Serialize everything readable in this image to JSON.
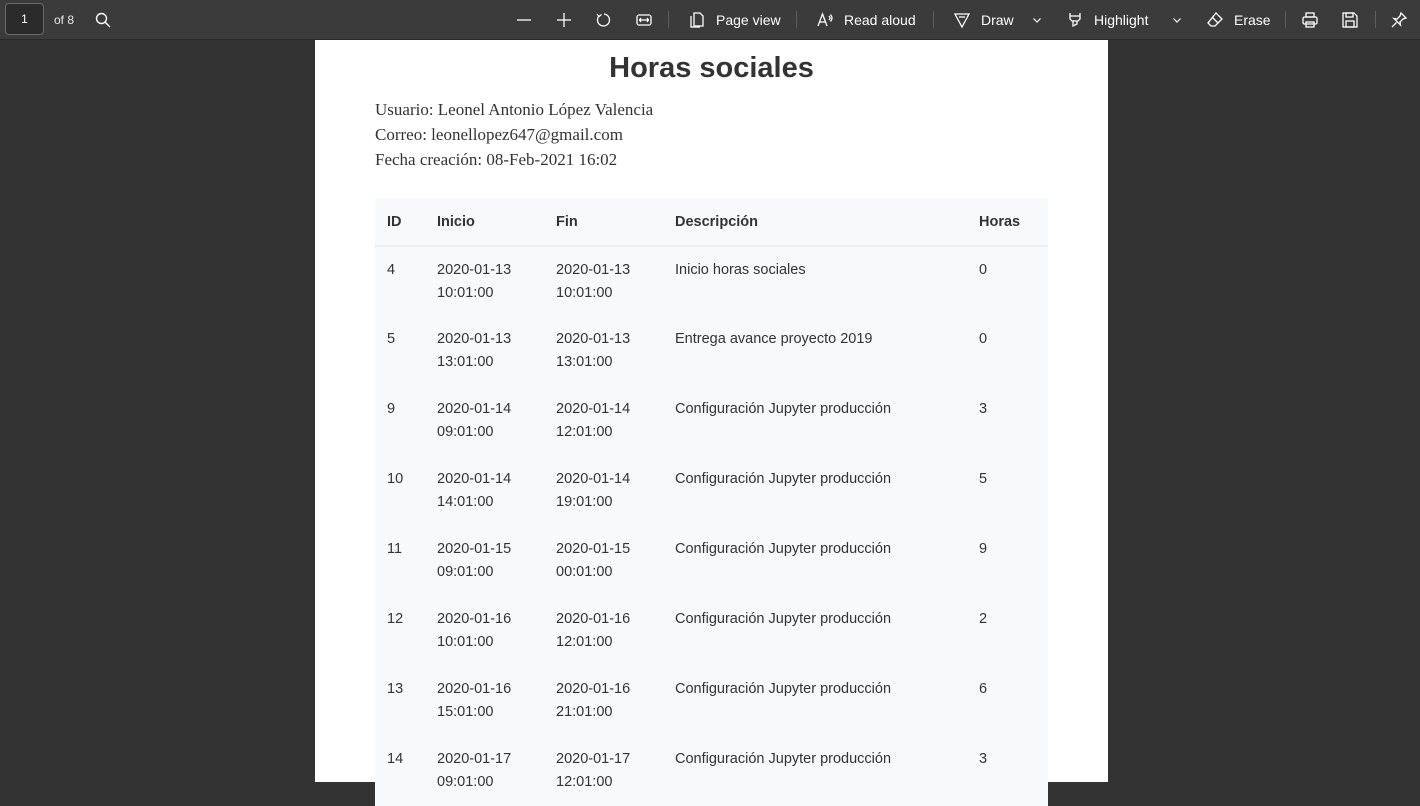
{
  "toolbar": {
    "page_number": "1",
    "page_total": "of 8",
    "page_view": "Page view",
    "read_aloud": "Read aloud",
    "draw": "Draw",
    "highlight": "Highlight",
    "erase": "Erase"
  },
  "document": {
    "title": "Horas sociales",
    "user": "Usuario: Leonel Antonio López Valencia",
    "email": "Correo: leonellopez647@gmail.com",
    "created": "Fecha creación: 08-Feb-2021 16:02",
    "columns": [
      "ID",
      "Inicio",
      "Fin",
      "Descripción",
      "Horas"
    ],
    "rows": [
      {
        "id": "4",
        "start_date": "2020-01-13",
        "start_time": "10:01:00",
        "end_date": "2020-01-13",
        "end_time": "10:01:00",
        "description": "Inicio horas sociales",
        "hours": "0"
      },
      {
        "id": "5",
        "start_date": "2020-01-13",
        "start_time": "13:01:00",
        "end_date": "2020-01-13",
        "end_time": "13:01:00",
        "description": "Entrega avance proyecto 2019",
        "hours": "0"
      },
      {
        "id": "9",
        "start_date": "2020-01-14",
        "start_time": "09:01:00",
        "end_date": "2020-01-14",
        "end_time": "12:01:00",
        "description": "Configuración Jupyter producción",
        "hours": "3"
      },
      {
        "id": "10",
        "start_date": "2020-01-14",
        "start_time": "14:01:00",
        "end_date": "2020-01-14",
        "end_time": "19:01:00",
        "description": "Configuración Jupyter producción",
        "hours": "5"
      },
      {
        "id": "11",
        "start_date": "2020-01-15",
        "start_time": "09:01:00",
        "end_date": "2020-01-15",
        "end_time": "00:01:00",
        "description": "Configuración Jupyter producción",
        "hours": "9"
      },
      {
        "id": "12",
        "start_date": "2020-01-16",
        "start_time": "10:01:00",
        "end_date": "2020-01-16",
        "end_time": "12:01:00",
        "description": "Configuración Jupyter producción",
        "hours": "2"
      },
      {
        "id": "13",
        "start_date": "2020-01-16",
        "start_time": "15:01:00",
        "end_date": "2020-01-16",
        "end_time": "21:01:00",
        "description": "Configuración Jupyter producción",
        "hours": "6"
      },
      {
        "id": "14",
        "start_date": "2020-01-17",
        "start_time": "09:01:00",
        "end_date": "2020-01-17",
        "end_time": "12:01:00",
        "description": "Configuración Jupyter producción",
        "hours": "3"
      }
    ]
  }
}
